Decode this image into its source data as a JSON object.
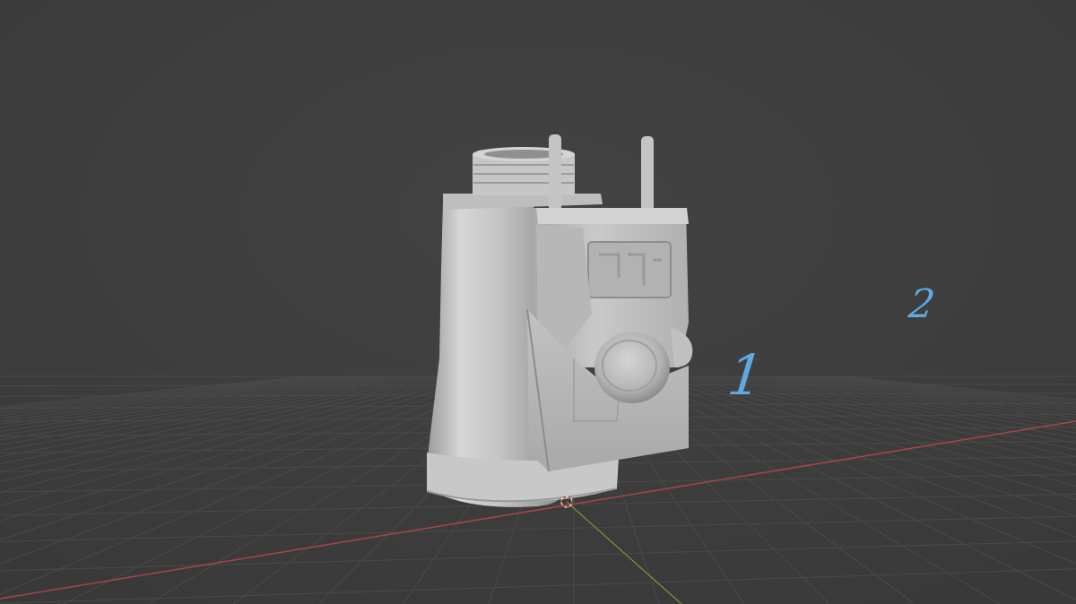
{
  "viewport": {
    "background_color": "#3d3d3d",
    "grid_color": "#4a4a4a",
    "x_axis_color": "#b5474e",
    "y_axis_color": "#7fa03f",
    "model_color": "#cfcfcf"
  },
  "annotations": {
    "label_1": "1",
    "label_2": "2",
    "color": "#5fa8e0"
  }
}
